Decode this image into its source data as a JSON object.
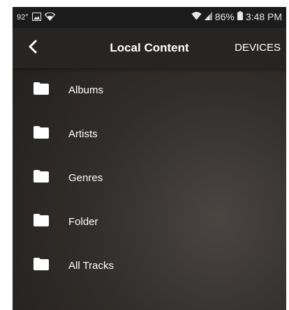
{
  "status_bar": {
    "temperature": "92°",
    "battery": "86%",
    "time": "3:48 PM"
  },
  "app_bar": {
    "title": "Local Content",
    "devices_label": "DEVICES"
  },
  "items": [
    {
      "label": "Albums"
    },
    {
      "label": "Artists"
    },
    {
      "label": "Genres"
    },
    {
      "label": "Folder"
    },
    {
      "label": "All Tracks"
    }
  ]
}
